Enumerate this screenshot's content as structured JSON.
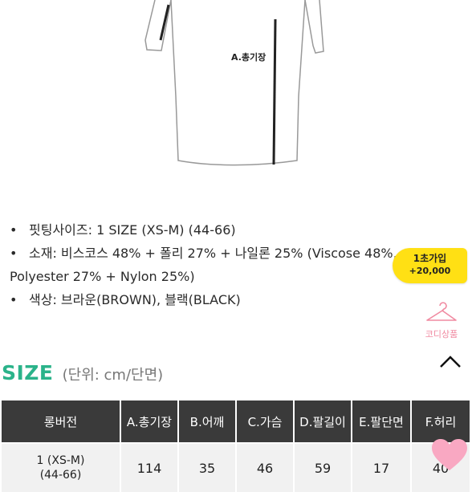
{
  "illustration": {
    "label": "A.총기장"
  },
  "product_info": {
    "fit": "핏팅사이즈: 1 SIZE (XS-M) (44-66)",
    "material_line1": "소재: 비스코스 48% + 폴리 27% + 나일론 25% (Viscose 48%,",
    "material_line2": "Polyester 27% + Nylon 25%)",
    "color": "색상: 브라운(BROWN), 블랙(BLACK)",
    "bullet": "•"
  },
  "promo": {
    "line1": "1초가입",
    "line2": "+20,000"
  },
  "coordi": {
    "label": "코디상품",
    "icon": "hanger-icon"
  },
  "size_section": {
    "title": "SIZE",
    "unit": "(단위: cm/단면)"
  },
  "size_table": {
    "headers": [
      "롱버전",
      "A.총기장",
      "B.어깨",
      "C.가슴",
      "D.팔길이",
      "E.팔단면",
      "F.허리"
    ],
    "rows": [
      {
        "size_line1": "1 (XS-M)",
        "size_line2": "(44-66)",
        "values": [
          "114",
          "35",
          "46",
          "59",
          "17",
          "40"
        ]
      }
    ]
  },
  "colors": {
    "accent_green": "#2bb38a",
    "header_dark": "#3a3a3a",
    "promo_yellow": "#ffe014",
    "pink": "#f08aa1"
  }
}
